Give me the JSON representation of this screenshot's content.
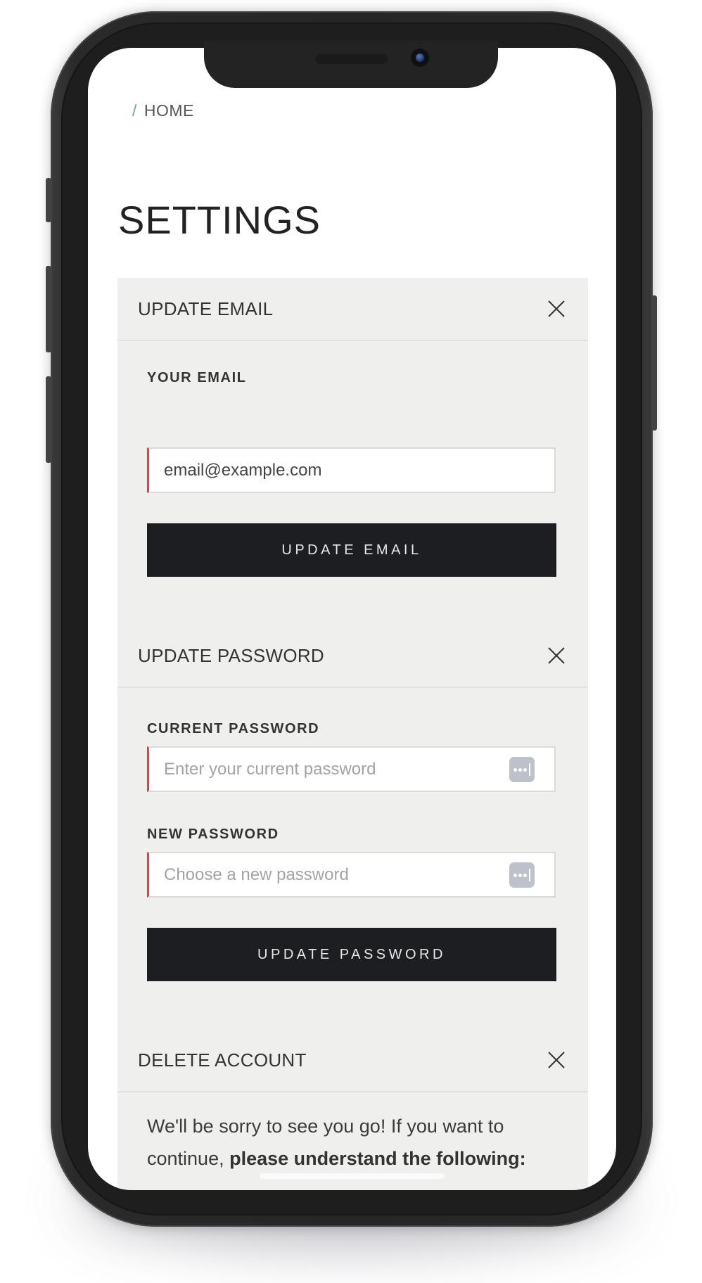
{
  "breadcrumb": {
    "separator": "/",
    "current": "HOME"
  },
  "page": {
    "title": "SETTINGS"
  },
  "sections": {
    "email": {
      "title": "UPDATE EMAIL",
      "close_icon": "close-icon",
      "field_label": "YOUR EMAIL",
      "field_value": "email@example.com",
      "button_label": "UPDATE EMAIL"
    },
    "password": {
      "title": "UPDATE PASSWORD",
      "close_icon": "close-icon",
      "current_label": "CURRENT PASSWORD",
      "current_placeholder": "Enter your current password",
      "new_label": "NEW PASSWORD",
      "new_placeholder": "Choose a new password",
      "key_icon": "password-autofill-icon",
      "button_label": "UPDATE PASSWORD"
    },
    "delete": {
      "title": "DELETE ACCOUNT",
      "close_icon": "close-icon",
      "text_normal": "We'll be sorry to see you go! If you want to continue, ",
      "text_bold": "please understand the following:"
    }
  },
  "colors": {
    "panel_bg": "#eff0ee",
    "button_bg": "#1d1e21",
    "input_accent": "#cc4a50",
    "breadcrumb_separator": "#7fa08c"
  }
}
